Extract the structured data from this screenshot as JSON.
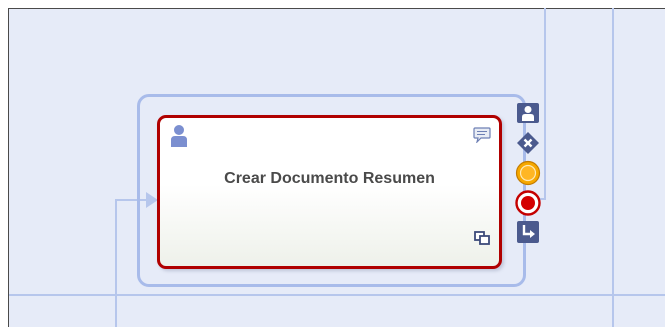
{
  "task": {
    "title": "Crear Documento Resumen",
    "border_color": "#b00000"
  },
  "icons": {
    "task_type": "user-task-icon",
    "task_comment": "comment-icon",
    "task_subprocess": "multi-instance-icon",
    "palette": [
      "add-user-task-icon",
      "exclusive-gateway-icon",
      "intermediate-event-icon",
      "end-event-icon",
      "connector-icon"
    ]
  },
  "colors": {
    "canvas_background": "#e6ebf8",
    "lane_line": "#b6c6ec",
    "selection_frame": "#a8bbea",
    "icon_primary": "#3c4a7a"
  }
}
